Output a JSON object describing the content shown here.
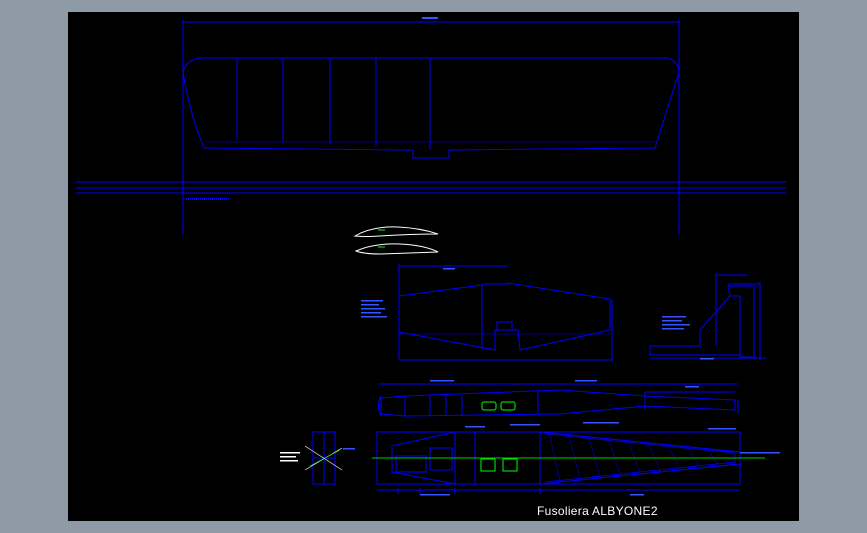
{
  "drawing": {
    "title": "Fusoliera ALBYONE2"
  },
  "colors": {
    "background": "#8e9aa6",
    "sheet": "#000000",
    "outline": "#0000ff",
    "annotation": "#3355ff",
    "airfoil": "#ffffff",
    "component": "#00ff00",
    "centerline": "#00cc00"
  }
}
